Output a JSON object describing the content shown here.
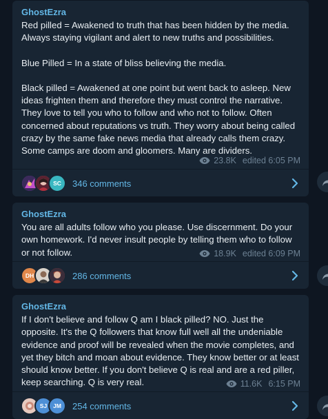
{
  "posts": [
    {
      "author": "GhostEzra",
      "paragraphs": [
        "Red pilled = Awakened to truth that has been hidden by the media. Always staying vigilant and alert to new truths and possibilities.",
        "Blue Pilled = In a state of bliss believing the media.",
        "Black pilled = Awakened at one point but went back to asleep. New ideas frighten them and therefore they must control the narrative. They love to tell you who to follow and who not to follow. Often concerned about reputations vs truth. They worry about being called crazy by the same fake news media that already calls them crazy. Some camps are doom and gloomers. Many are dividers."
      ],
      "views": "23.8K",
      "time": "edited 6:05 PM",
      "comments": "346 comments",
      "avatars": [
        {
          "initials": "",
          "color": "#8a3fb8",
          "kind": "photo"
        },
        {
          "initials": "",
          "color": "#c94a5a",
          "kind": "photo"
        },
        {
          "initials": "SC",
          "color": "#39b7c1",
          "kind": "initials"
        }
      ]
    },
    {
      "author": "GhostEzra",
      "paragraphs": [
        "You are all adults follow who you please. Use discernment. Do your own homework. I'd never insult people by telling them who to follow or not follow."
      ],
      "views": "18.9K",
      "time": "edited 6:09 PM",
      "comments": "286 comments",
      "avatars": [
        {
          "initials": "DH",
          "color": "#e0874a",
          "kind": "initials"
        },
        {
          "initials": "",
          "color": "#7a6a5a",
          "kind": "photo"
        },
        {
          "initials": "",
          "color": "#a4433d",
          "kind": "photo"
        }
      ]
    },
    {
      "author": "GhostEzra",
      "paragraphs": [
        "If I don't believe and follow Q am I black pilled? NO. Just the opposite. It's the Q followers that know full well all the undeniable evidence and proof will be revealed when the movie completes, and yet they bitch and moan about evidence. They know better or at least should know better. If you don't believe Q is real and are a red piller, keep searching. Q is very real."
      ],
      "views": "11.6K",
      "time": "6:15 PM",
      "comments": "254 comments",
      "avatars": [
        {
          "initials": "",
          "color": "#c9a397",
          "kind": "photo"
        },
        {
          "initials": "SJ",
          "color": "#4d8fd6",
          "kind": "initials"
        },
        {
          "initials": "JM",
          "color": "#4d8fd6",
          "kind": "initials"
        }
      ]
    }
  ]
}
